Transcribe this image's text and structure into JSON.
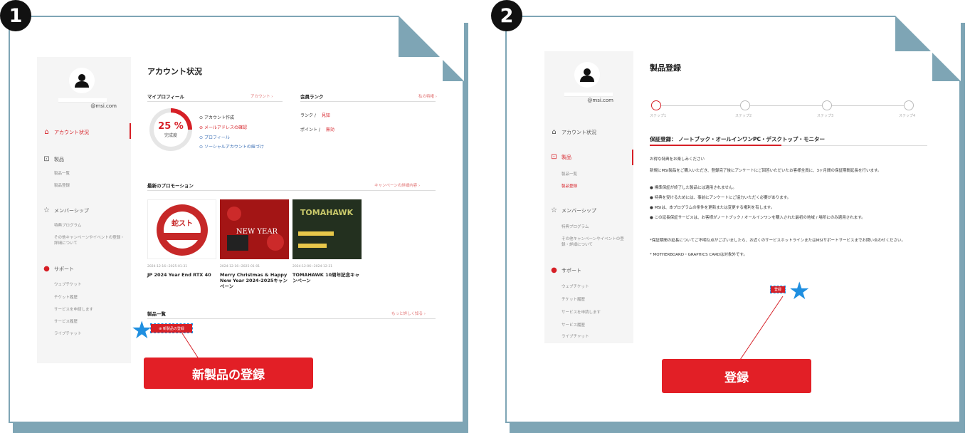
{
  "steps": [
    {
      "number": "1",
      "callout": "新製品の登録",
      "screen": {
        "email": "@msi.com",
        "sidebar": {
          "account": "アカウント状況",
          "products": "製品",
          "product_list": "製品一覧",
          "product_register": "製品登録",
          "membership": "メンバーシップ",
          "member_program": "特典プログラム",
          "other_campaign": "その他キャンペーンやイベントの登録・詳細について",
          "support": "サポート",
          "web_ticket": "ウェブチケット",
          "ticket_history": "チケット履歴",
          "apply_service": "サービスを申請します",
          "service_history": "サービス履歴",
          "live_chat": "ライブチャット"
        },
        "title": "アカウント状況",
        "my_profile": "マイプロフィール",
        "account_link": "アカウント ›",
        "member_rank": "会員ランク",
        "my_benefits_link": "私の特権 ›",
        "completion_pct": "25 %",
        "completion_label": "完成度",
        "checklist": [
          {
            "icon": "⊙",
            "text": "アカウント作成",
            "state": "normal"
          },
          {
            "icon": "⊘",
            "text": "メールアドレスの確認",
            "state": "red"
          },
          {
            "icon": "⊙",
            "text": "プロフィール",
            "state": "link"
          },
          {
            "icon": "⊙",
            "text": "ソーシャルアカウントの紐づけ",
            "state": "link"
          }
        ],
        "rank_label": "ランク /",
        "rank_value": "見知",
        "points_label": "ポイント /",
        "points_value": "無効",
        "promotions_title": "最新のプロモーション",
        "campaign_link": "キャンペーンの詳細内容 ›",
        "promotions": [
          {
            "date": "2024-12-16~2025-01-31",
            "title": "JP 2024 Year End RTX 40",
            "image_text": "蛇スト キャンペーン"
          },
          {
            "date": "2024-12-16~2025-01-01",
            "title": "Merry Christmas & Happy New Year 2024-2025キャンペーン",
            "image_text": "NEW YEAR"
          },
          {
            "date": "2024-12-06~2024-12-31",
            "title": "TOMAHAWK 10周年記念キャンペーン",
            "image_text": "TOMAHAWK"
          }
        ],
        "product_list_title": "製品一覧",
        "more_link": "もっと詳しく知る ›",
        "new_product_button": "⊕ 新製品の登録"
      }
    },
    {
      "number": "2",
      "callout": "登録",
      "screen": {
        "email": "@msi.com",
        "title": "製品登録",
        "steps": [
          "ステップ1",
          "ステップ2",
          "ステップ3",
          "ステップ4"
        ],
        "warranty_title": "保証登録： ノートブック・オールインワンPC・デスクトップ・モニター",
        "intro": "お得な特典をお楽しみください",
        "description": "新規にMSI製品をご購入いただき、登録完了後にアンケートにご回答いただいたお客様全員に、3ヶ月間の保証期間延長を行います。",
        "bullets": [
          "標準保証が終了した製品には適用されません。",
          "特典を受けるためには、事前にアンケートにご協力いただく必要があります。",
          "MSIは、本プログラムの条件を更新または変更する権利を有します。",
          "この延長保証サービスは、お客様がノートブック / オールインワンを購入された最初の地域 / 場所にのみ適用されます。"
        ],
        "note": "*保証期間の延長についてご不明な点がございましたら、お近くのサービスホットラインまたはMSIサポートサービスまでお問い合わせください。",
        "note2": "* MOTHERBOARD・GRAPHICS CARDは対象外です。",
        "register_button": "登録"
      }
    }
  ],
  "colors": {
    "accent": "#d61f26",
    "frame": "#7ea5b5",
    "star": "#1f8fe0"
  }
}
